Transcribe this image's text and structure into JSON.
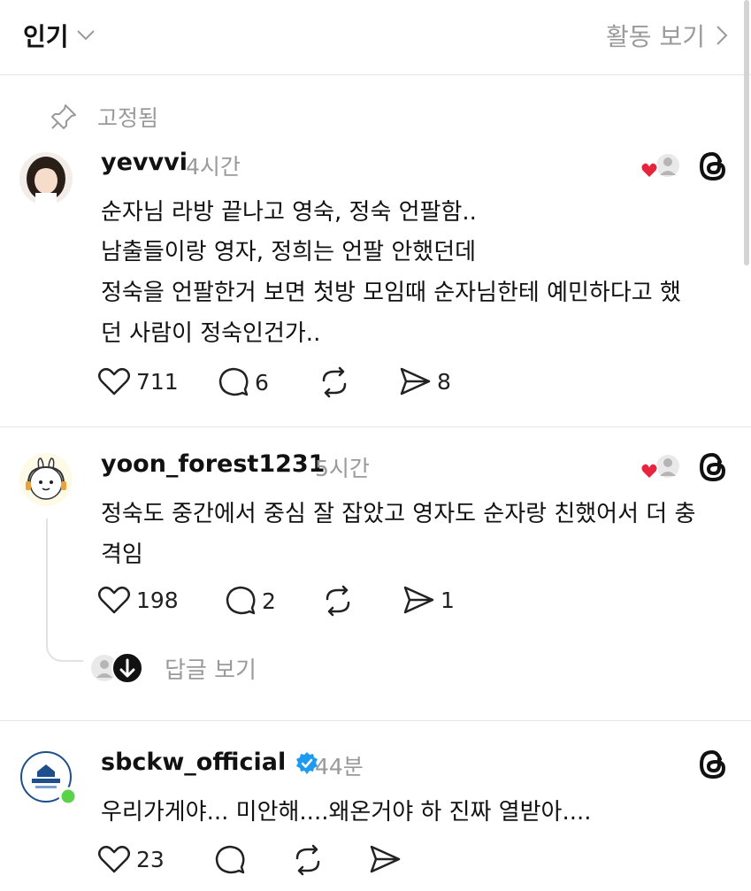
{
  "header": {
    "sort_label": "인기",
    "activity_label": "활동 보기"
  },
  "pinned_label": "고정됨",
  "posts": [
    {
      "username": "yevvvi",
      "time": "4시간",
      "lines": [
        "순자님 라방 끝나고 영숙, 정숙 언팔함..",
        "남출들이랑 영자, 정희는 언팔 안했던데",
        "정숙을 언팔한거 보면 첫방 모임때 순자님한테 예민하다고 했",
        "던 사람이 정숙인건가.."
      ],
      "likes": "711",
      "comments": "6",
      "shares": "8"
    },
    {
      "username": "yoon_forest1231",
      "time": "5시간",
      "lines": [
        "정숙도 중간에서 중심 잘 잡았고 영자도 순자랑 친했어서 더 충",
        "격임"
      ],
      "likes": "198",
      "comments": "2",
      "shares": "1",
      "view_replies": "답글 보기"
    },
    {
      "username": "sbckw_official",
      "time": "44분",
      "lines": [
        "우리가게야... 미안해....왜온거야 하 진짜 열받아...."
      ],
      "likes": "23"
    }
  ],
  "colors": {
    "like_red": "#e8233c",
    "muted": "#9a9a9a",
    "verified_blue": "#1d9bf0",
    "online_green": "#5ad34b"
  }
}
